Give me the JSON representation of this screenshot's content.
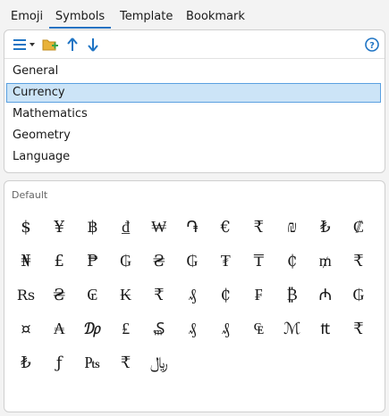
{
  "tabs": {
    "emoji": "Emoji",
    "symbols": "Symbols",
    "template": "Template",
    "bookmark": "Bookmark"
  },
  "toolbar": {
    "icons": [
      "menu-icon",
      "chevron-down-icon",
      "new-folder-icon",
      "arrow-up-icon",
      "arrow-down-icon",
      "help-icon"
    ],
    "accent": "#1f74c4",
    "folder_color": "#e8b23a",
    "plus_color": "#3aa648"
  },
  "categories": {
    "items": [
      "General",
      "Currency",
      "Mathematics",
      "Geometry",
      "Language"
    ],
    "selected": "Currency"
  },
  "symbols": {
    "section_label": "Default",
    "items": [
      "$",
      "¥",
      "฿",
      "₫",
      "₩",
      "֏",
      "€",
      "₹",
      "₪",
      "₺",
      "₡",
      "₦",
      "£",
      "₱",
      "₲",
      "₴",
      "₲",
      "₮",
      "₸",
      "₵",
      "₥",
      "₹",
      "Rs",
      "₴",
      "₢",
      "₭",
      "₹",
      "₰",
      "₵",
      "₣",
      "₿",
      "₼",
      "₲",
      "¤",
      "₳",
      "₯",
      "₤",
      "₷",
      "₰",
      "₰",
      "₠",
      "ℳ",
      "₶",
      "₹",
      "₺",
      "ƒ",
      "₧",
      "₹",
      "﷼"
    ]
  }
}
